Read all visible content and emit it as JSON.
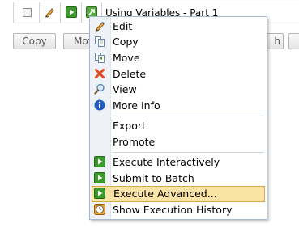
{
  "row": {
    "title": "Using Variables - Part 1"
  },
  "buttons": {
    "copy": "Copy",
    "move_partial": "Mov",
    "h_partial": "h"
  },
  "menu": {
    "group1": [
      {
        "key": "edit",
        "label": "Edit",
        "icon": "pencil-icon"
      },
      {
        "key": "copy",
        "label": "Copy",
        "icon": "copy-icon"
      },
      {
        "key": "move",
        "label": "Move",
        "icon": "move-icon"
      },
      {
        "key": "delete",
        "label": "Delete",
        "icon": "delete-x-icon"
      },
      {
        "key": "view",
        "label": "View",
        "icon": "magnifier-icon"
      },
      {
        "key": "more-info",
        "label": "More Info",
        "icon": "info-icon"
      }
    ],
    "group2": [
      {
        "key": "export",
        "label": "Export"
      },
      {
        "key": "promote",
        "label": "Promote"
      }
    ],
    "group3": [
      {
        "key": "execute-interactively",
        "label": "Execute Interactively",
        "icon": "play-icon"
      },
      {
        "key": "submit-to-batch",
        "label": "Submit to Batch",
        "icon": "play-icon"
      },
      {
        "key": "execute-advanced",
        "label": "Execute Advanced...",
        "icon": "play-icon",
        "highlighted": true
      },
      {
        "key": "show-execution-history",
        "label": "Show Execution History",
        "icon": "history-clock-icon"
      }
    ]
  },
  "colors": {
    "highlight_bg": "#fbe3a6",
    "highlight_border": "#d9a846",
    "play_green": "#3a9a2a",
    "delete_red": "#e04b1f",
    "info_blue": "#1f5fbf"
  }
}
